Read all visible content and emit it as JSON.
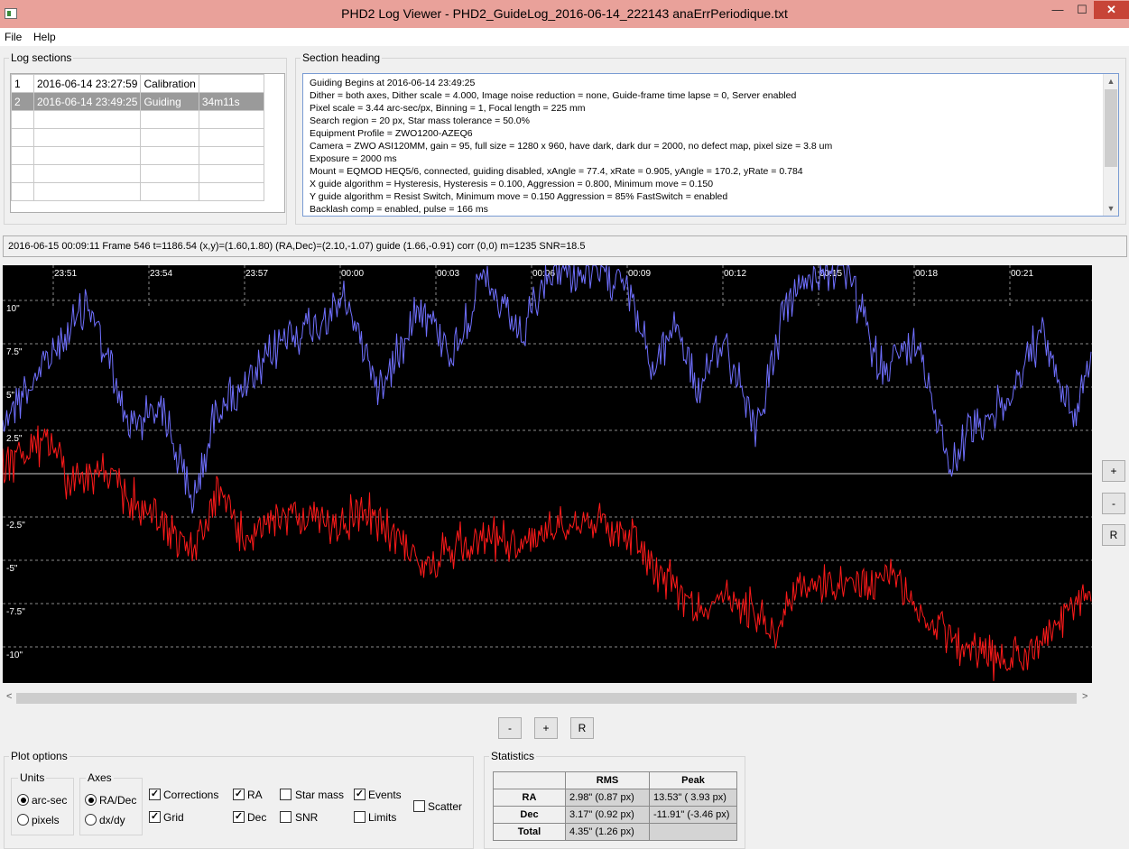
{
  "window": {
    "title": "PHD2 Log Viewer - PHD2_GuideLog_2016-06-14_222143 anaErrPeriodique.txt",
    "minimize": "—",
    "maximize": "☐",
    "close": "✕"
  },
  "menu": [
    "File",
    "Help"
  ],
  "log_sections": {
    "label": "Log sections",
    "rows": [
      {
        "num": "1",
        "time": "2016-06-14 23:27:59",
        "type": "Calibration",
        "dur": ""
      },
      {
        "num": "2",
        "time": "2016-06-14 23:49:25",
        "type": "Guiding",
        "dur": "34m11s"
      }
    ]
  },
  "section_heading": {
    "label": "Section heading",
    "lines": [
      "Guiding Begins at 2016-06-14 23:49:25",
      "Dither = both axes, Dither scale = 4.000, Image noise reduction = none, Guide-frame time lapse = 0, Server enabled",
      "Pixel scale = 3.44 arc-sec/px, Binning = 1, Focal length = 225 mm",
      "Search region = 20 px, Star mass tolerance = 50.0%",
      "Equipment Profile = ZWO1200-AZEQ6",
      "Camera = ZWO ASI120MM, gain = 95, full size = 1280 x 960, have dark, dark dur = 2000, no defect map, pixel size = 3.8 um",
      "Exposure = 2000 ms",
      "Mount = EQMOD HEQ5/6,  connected, guiding disabled, xAngle = 77.4, xRate = 0.905, yAngle = 170.2, yRate = 0.784",
      "X guide algorithm = Hysteresis, Hysteresis = 0.100, Aggression = 0.800, Minimum move = 0.150",
      "Y guide algorithm = Resist Switch, Minimum move = 0.150 Aggression = 85% FastSwitch = enabled",
      "Backlash comp = enabled, pulse = 166 ms"
    ]
  },
  "status_line": "2016-06-15 00:09:11 Frame 546 t=1186.54 (x,y)=(1.60,1.80) (RA,Dec)=(2.10,-1.07) guide (1.66,-0.91) corr (0,0) m=1235 SNR=18.5",
  "graph": {
    "time_labels": [
      "23:51",
      "23:54",
      "23:57",
      "00:00",
      "00:03",
      "00:06",
      "00:09",
      "00:12",
      "00:15",
      "00:18",
      "00:21"
    ],
    "y_labels": [
      "10\"",
      "7.5\"",
      "5\"",
      "2.5\"",
      "-2.5\"",
      "-5\"",
      "-7.5\"",
      "-10\""
    ],
    "ra_color": "#7070ff",
    "dec_color": "#ff1a1a",
    "grid_color": "#8a8a8a",
    "zero_color": "#d0d0d0"
  },
  "zoom_side": {
    "plus": "+",
    "minus": "-",
    "reset": "R"
  },
  "zoom_bottom": {
    "minus": "-",
    "plus": "+",
    "reset": "R"
  },
  "scroll": {
    "left": "<",
    "right": ">"
  },
  "plot_options": {
    "label": "Plot options",
    "units_label": "Units",
    "units": [
      {
        "label": "arc-sec",
        "selected": true
      },
      {
        "label": "pixels",
        "selected": false
      }
    ],
    "axes_label": "Axes",
    "axes": [
      {
        "label": "RA/Dec",
        "selected": true
      },
      {
        "label": "dx/dy",
        "selected": false
      }
    ],
    "checks": {
      "corrections": "Corrections",
      "grid": "Grid",
      "ra": "RA",
      "dec": "Dec",
      "star_mass": "Star mass",
      "snr": "SNR",
      "events": "Events",
      "limits": "Limits",
      "scatter": "Scatter"
    },
    "check_mark": "✓"
  },
  "statistics": {
    "label": "Statistics",
    "headers": [
      "",
      "RMS",
      "Peak"
    ],
    "rows": [
      {
        "name": "RA",
        "rms": "2.98\" (0.87 px)",
        "peak": "13.53\" ( 3.93 px)"
      },
      {
        "name": "Dec",
        "rms": "3.17\" (0.92 px)",
        "peak": "-11.91\" (-3.46 px)"
      },
      {
        "name": "Total",
        "rms": "4.35\" (1.26 px)",
        "peak": ""
      }
    ]
  }
}
